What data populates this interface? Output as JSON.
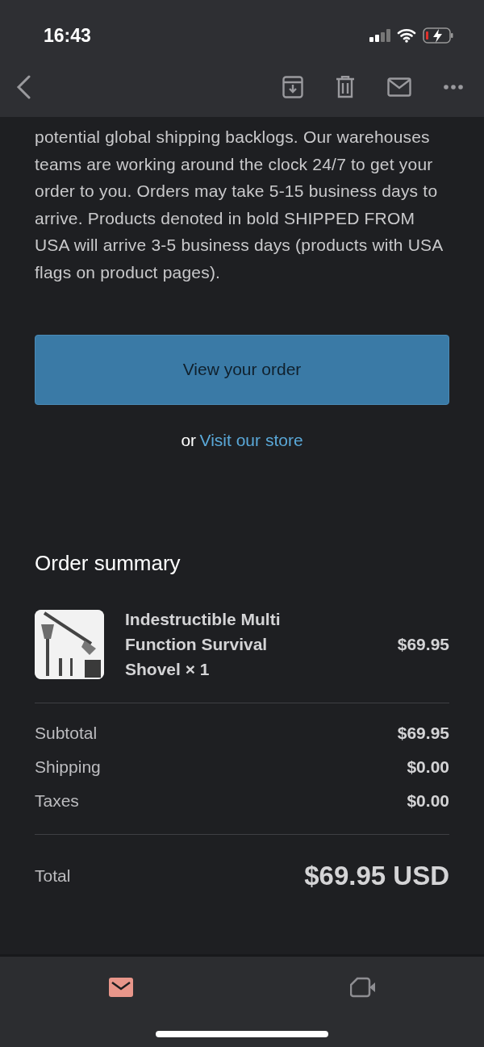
{
  "status_bar": {
    "time": "16:43"
  },
  "message": {
    "paragraph": "potential global shipping backlogs. Our warehouses teams are working around the clock 24/7 to get your order to you. Orders may take 5-15 business days to arrive. Products denoted in bold SHIPPED FROM USA will arrive 3-5 business days (products with USA flags on product pages).",
    "primary_button": "View your order",
    "or_text": "or",
    "store_link": "Visit our store"
  },
  "order_summary": {
    "title": "Order summary",
    "items": [
      {
        "name": "Indestructible Multi Function Survival Shovel × 1",
        "price": "$69.95"
      }
    ],
    "lines": [
      {
        "label": "Subtotal",
        "value": "$69.95"
      },
      {
        "label": "Shipping",
        "value": "$0.00"
      },
      {
        "label": "Taxes",
        "value": "$0.00"
      }
    ],
    "total": {
      "label": "Total",
      "value": "$69.95 USD"
    }
  },
  "tab_bar": [
    {
      "kind": "mail",
      "selected": true
    },
    {
      "kind": "video",
      "selected": false
    }
  ]
}
